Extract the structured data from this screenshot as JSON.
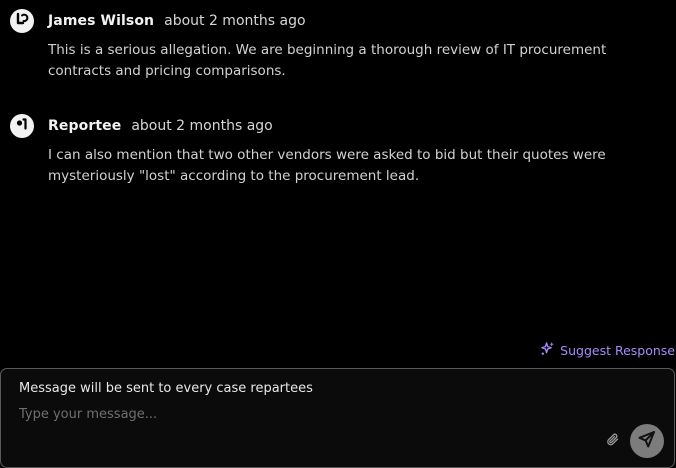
{
  "messages": [
    {
      "author": "James Wilson",
      "time": "about 2 months ago",
      "avatar_icon": "logo-avatar-icon",
      "body": "This is a serious allegation. We are beginning a thorough review of IT procurement contracts and pricing comparisons."
    },
    {
      "author": "Reportee",
      "time": "about 2 months ago",
      "avatar_icon": "anonymous-avatar-icon",
      "body": "I can also mention that two other vendors were asked to bid but their quotes were mysteriously \"lost\" according to the procurement lead."
    }
  ],
  "suggest": {
    "label": "Suggest Response",
    "icon": "sparkles-icon",
    "color": "#a78bfa"
  },
  "composer": {
    "notice": "Message will be sent to every case repartees",
    "placeholder": "Type your message...",
    "attach_icon": "paperclip-icon",
    "send_icon": "send-icon"
  },
  "colors": {
    "background": "#000000",
    "send_button": "#7c7c7c",
    "accent": "#a78bfa"
  }
}
